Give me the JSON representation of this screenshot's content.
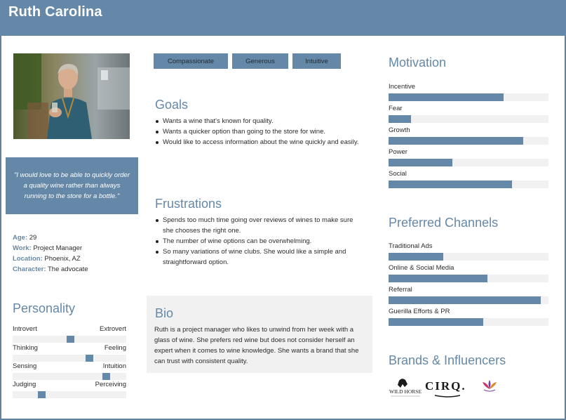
{
  "persona": {
    "name": "Ruth Carolina"
  },
  "quote": "\"I would love to be able to quickly order a quality wine rather than always running to the store for a bottle.\"",
  "facts": [
    {
      "key": "Age:",
      "value": "29"
    },
    {
      "key": "Work:",
      "value": "Project Manager"
    },
    {
      "key": "Location:",
      "value": "Phoenix, AZ"
    },
    {
      "key": "Character:",
      "value": "The advocate"
    }
  ],
  "personality": {
    "title": "Personality",
    "rows": [
      {
        "left": "Introvert",
        "right": "Extrovert",
        "position": 0.51
      },
      {
        "left": "Thinking",
        "right": "Feeling",
        "position": 0.69
      },
      {
        "left": "Sensing",
        "right": "Intuition",
        "position": 0.85
      },
      {
        "left": "Judging",
        "right": "Perceiving",
        "position": 0.24
      }
    ]
  },
  "traits": [
    "Compassionate",
    "Generous",
    "Intuitive"
  ],
  "goals": {
    "title": "Goals",
    "items": [
      "Wants a wine that's known for quality.",
      "Wants a quicker option than going to the store for wine.",
      "Would like to access information about the wine quickly and easily."
    ]
  },
  "frustrations": {
    "title": "Frustrations",
    "items": [
      "Spends too much time going over reviews of wines to make sure she chooses the right one.",
      "The number of wine options can be overwhelming.",
      "So many variations of wine clubs. She would like a simple and straightforward option."
    ]
  },
  "bio": {
    "title": "Bio",
    "text": "Ruth is a project manager who likes to unwind from her week with a glass of wine. She prefers red wine but does not consider herself an expert when it comes to wine knowledge. She wants a brand that she can trust with consistent quality."
  },
  "motivation": {
    "title": "Motivation",
    "items": [
      {
        "label": "Incentive",
        "value": 0.72
      },
      {
        "label": "Fear",
        "value": 0.14
      },
      {
        "label": "Growth",
        "value": 0.84
      },
      {
        "label": "Power",
        "value": 0.4
      },
      {
        "label": "Social",
        "value": 0.77
      }
    ]
  },
  "channels": {
    "title": "Preferred Channels",
    "items": [
      {
        "label": "Traditional Ads",
        "value": 0.34
      },
      {
        "label": "Online & Social Media",
        "value": 0.62
      },
      {
        "label": "Referral",
        "value": 0.95
      },
      {
        "label": "Guerilla Efforts & PR",
        "value": 0.59
      }
    ]
  },
  "brands": {
    "title": "Brands & Influencers",
    "logos": [
      {
        "name": "wild-horse-logo",
        "text": "WILD HORSE"
      },
      {
        "name": "cirq-logo",
        "text": "CIRQ."
      },
      {
        "name": "lotus-logo",
        "text": ""
      }
    ]
  },
  "colors": {
    "accent": "#6588a8",
    "track": "#f1f1f2",
    "panel": "#f1f1f2"
  }
}
